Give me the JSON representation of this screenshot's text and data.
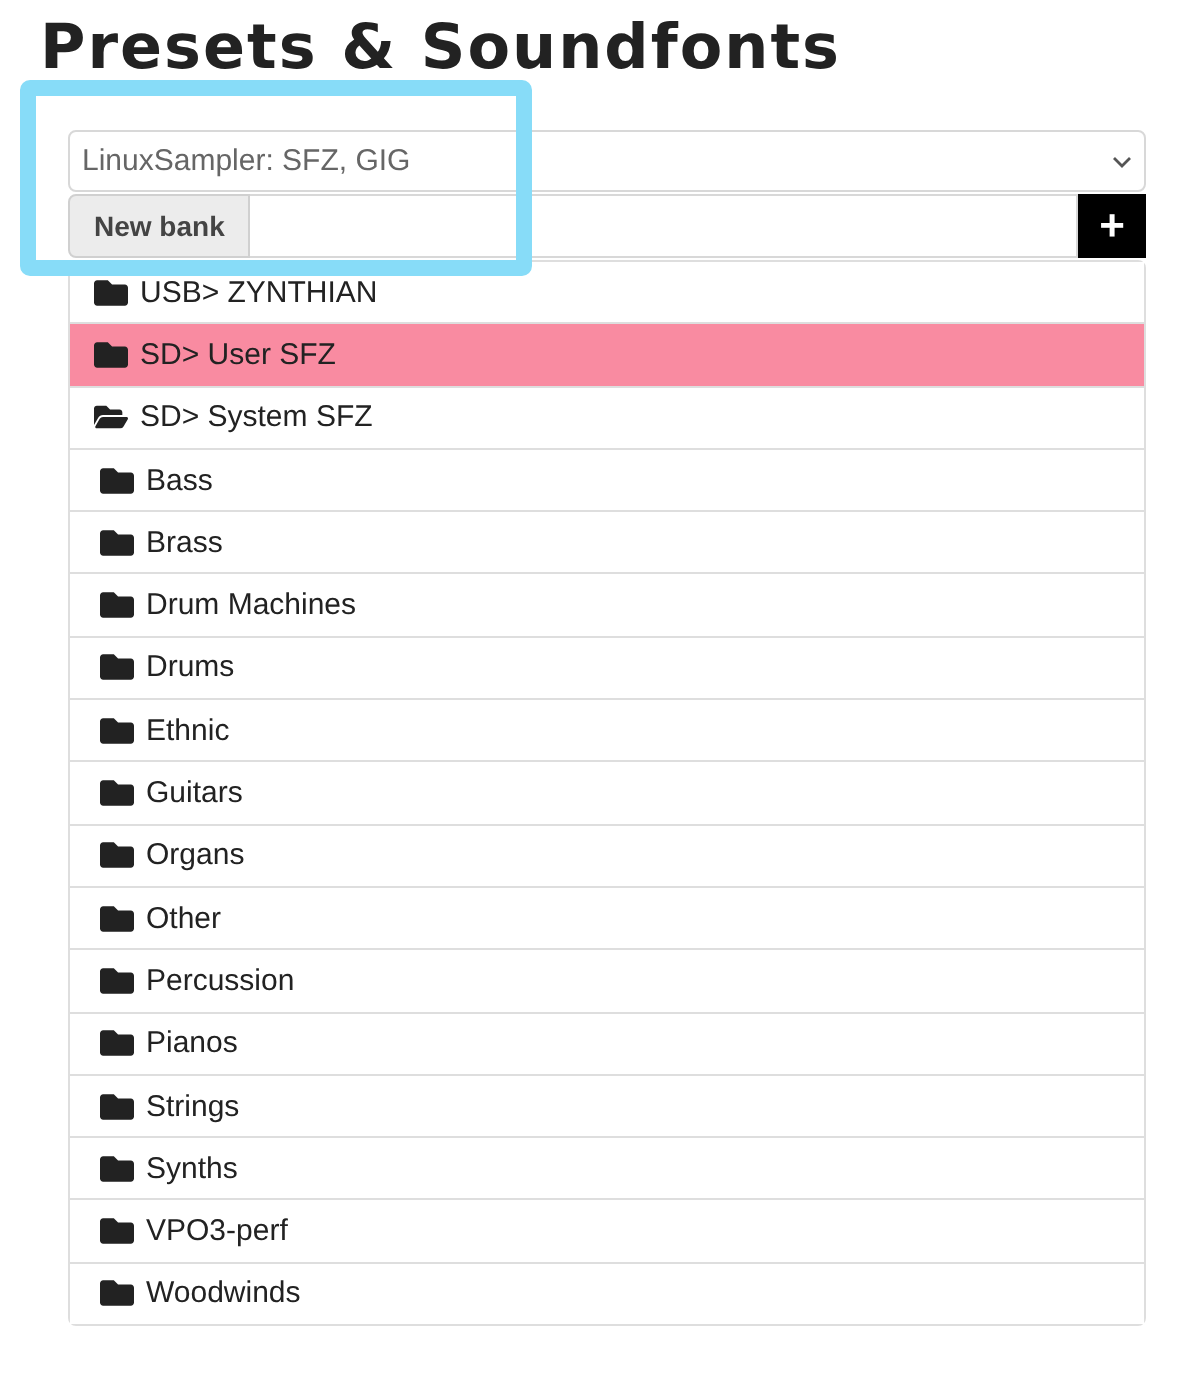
{
  "title": "Presets & Soundfonts",
  "engine_select": {
    "value": "LinuxSampler: SFZ, GIG"
  },
  "new_bank": {
    "label": "New bank",
    "add_button": "+"
  },
  "banks": [
    {
      "name": "USB> ZYNTHIAN",
      "selected": false,
      "expanded": false
    },
    {
      "name": "SD> User SFZ",
      "selected": true,
      "expanded": false
    },
    {
      "name": "SD> System SFZ",
      "selected": false,
      "expanded": true,
      "children": [
        {
          "name": "Bass",
          "selected": false
        },
        {
          "name": "Brass",
          "selected": false
        },
        {
          "name": "Drum Machines",
          "selected": false
        },
        {
          "name": "Drums",
          "selected": false
        },
        {
          "name": "Ethnic",
          "selected": false
        },
        {
          "name": "Guitars",
          "selected": false
        },
        {
          "name": "Organs",
          "selected": false
        },
        {
          "name": "Other",
          "selected": false
        },
        {
          "name": "Percussion",
          "selected": false
        },
        {
          "name": "Pianos",
          "selected": false
        },
        {
          "name": "Strings",
          "selected": false
        },
        {
          "name": "Synths",
          "selected": false
        },
        {
          "name": "VPO3-perf",
          "selected": false
        },
        {
          "name": "Woodwinds",
          "selected": false
        }
      ]
    }
  ]
}
